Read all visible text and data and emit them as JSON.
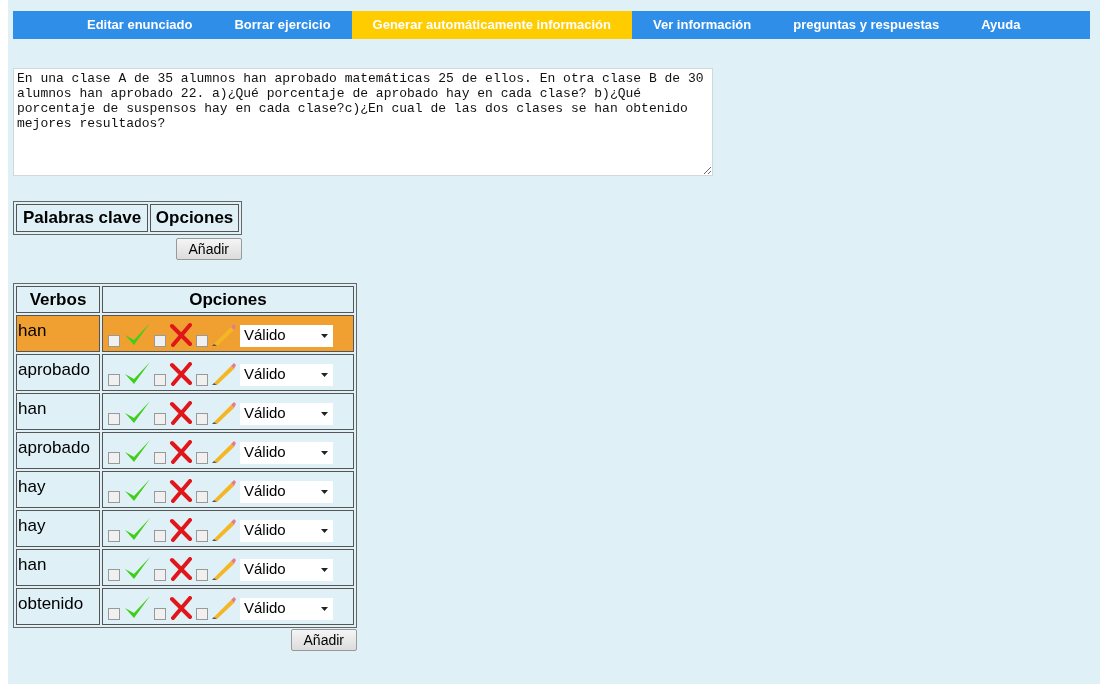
{
  "nav": [
    {
      "label": "Editar enunciado",
      "selected": false
    },
    {
      "label": "Borrar ejercicio",
      "selected": false
    },
    {
      "label": "Generar automáticamente información",
      "selected": true
    },
    {
      "label": "Ver información",
      "selected": false
    },
    {
      "label": "preguntas y respuestas",
      "selected": false
    },
    {
      "label": "Ayuda",
      "selected": false
    }
  ],
  "statement": "En una clase A de 35 alumnos han aprobado matemáticas 25 de ellos. En otra clase B de 30 alumnos han aprobado 22. a)¿Qué porcentaje de aprobado hay en cada clase? b)¿Qué porcentaje de suspensos hay en cada clase?c)¿En cual de las dos clases se han obtenido mejores resultados?",
  "keywords_table": {
    "columns": [
      "Palabras clave",
      "Opciones"
    ],
    "add_button": "Añadir"
  },
  "verbs_table": {
    "columns": [
      "Verbos",
      "Opciones"
    ],
    "add_button": "Añadir",
    "rows": [
      {
        "word": "han",
        "selected": true,
        "valid_checked": false,
        "invalid_checked": false,
        "edit_checked": false,
        "status": "Válido"
      },
      {
        "word": "aprobado",
        "selected": false,
        "valid_checked": false,
        "invalid_checked": false,
        "edit_checked": false,
        "status": "Válido"
      },
      {
        "word": "han",
        "selected": false,
        "valid_checked": false,
        "invalid_checked": false,
        "edit_checked": false,
        "status": "Válido"
      },
      {
        "word": "aprobado",
        "selected": false,
        "valid_checked": false,
        "invalid_checked": false,
        "edit_checked": false,
        "status": "Válido"
      },
      {
        "word": "hay",
        "selected": false,
        "valid_checked": false,
        "invalid_checked": false,
        "edit_checked": false,
        "status": "Válido"
      },
      {
        "word": "hay",
        "selected": false,
        "valid_checked": false,
        "invalid_checked": false,
        "edit_checked": false,
        "status": "Válido"
      },
      {
        "word": "han",
        "selected": false,
        "valid_checked": false,
        "invalid_checked": false,
        "edit_checked": false,
        "status": "Válido"
      },
      {
        "word": "obtenido",
        "selected": false,
        "valid_checked": false,
        "invalid_checked": false,
        "edit_checked": false,
        "status": "Válido"
      }
    ]
  }
}
